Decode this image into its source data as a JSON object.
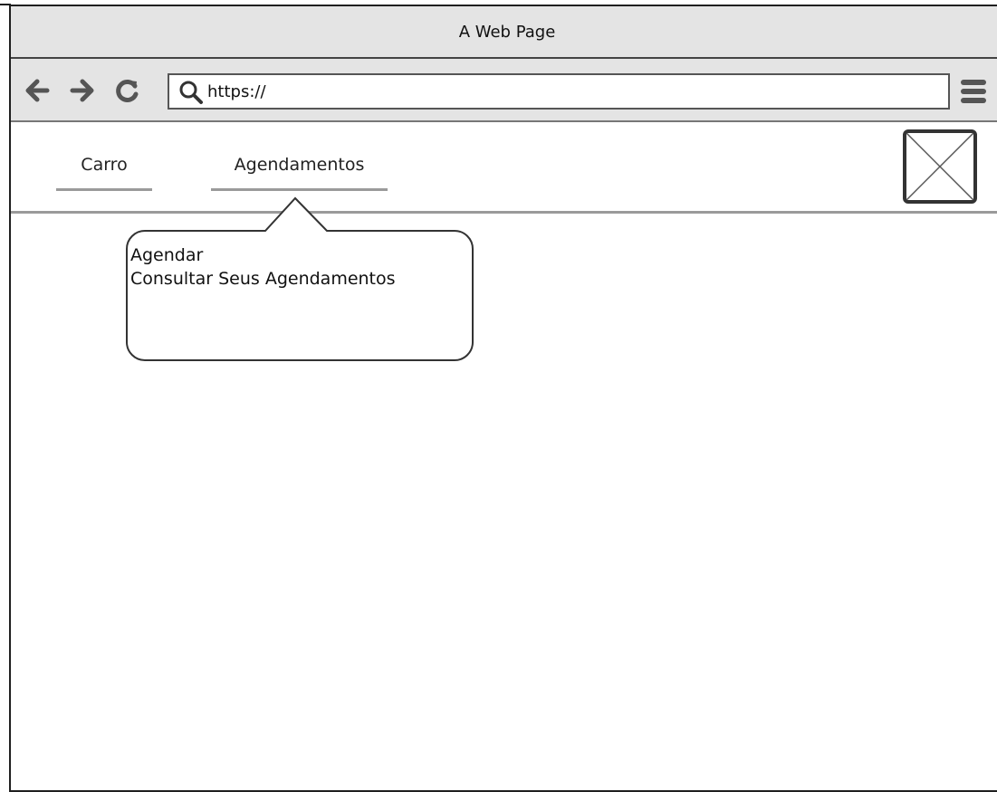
{
  "window": {
    "title": "A Web Page"
  },
  "toolbar": {
    "url": "https://",
    "back_icon": "arrow-left-icon",
    "forward_icon": "arrow-right-icon",
    "reload_icon": "reload-icon",
    "search_icon": "search-icon",
    "menu_icon": "hamburger-menu-icon"
  },
  "nav": {
    "tabs": [
      {
        "label": "Carro"
      },
      {
        "label": "Agendamentos"
      }
    ]
  },
  "dropdown": {
    "items": [
      {
        "label": "Agendar"
      },
      {
        "label": "Consultar Seus Agendamentos"
      }
    ]
  },
  "logo": {
    "icon": "image-placeholder-icon"
  }
}
